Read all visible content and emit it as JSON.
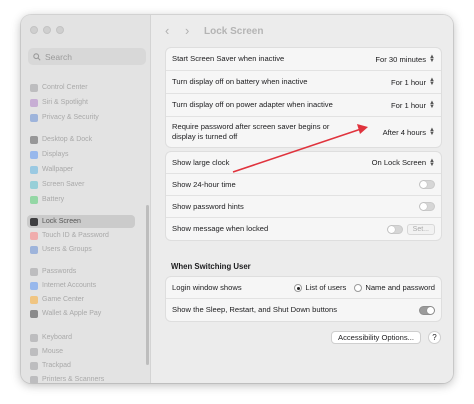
{
  "window": {
    "title": "Lock Screen"
  },
  "sidebar": {
    "search_placeholder": "Search",
    "items": [
      {
        "label": "Control Center",
        "icon": "control-center-icon",
        "color": "#8e8e93"
      },
      {
        "label": "Siri & Spotlight",
        "icon": "siri-icon",
        "color": "#a56cc1"
      },
      {
        "label": "Privacy & Security",
        "icon": "hand-icon",
        "color": "#4a7bd0"
      },
      {
        "label": "Desktop & Dock",
        "icon": "dock-icon",
        "color": "#3a3a3c"
      },
      {
        "label": "Displays",
        "icon": "display-icon",
        "color": "#3b82f6"
      },
      {
        "label": "Wallpaper",
        "icon": "wallpaper-icon",
        "color": "#40a9e0"
      },
      {
        "label": "Screen Saver",
        "icon": "screen-saver-icon",
        "color": "#39b5c9"
      },
      {
        "label": "Battery",
        "icon": "battery-icon",
        "color": "#34c759"
      },
      {
        "label": "Lock Screen",
        "icon": "lock-icon",
        "color": "#1c1c1e"
      },
      {
        "label": "Touch ID & Password",
        "icon": "fingerprint-icon",
        "color": "#ff6b6b"
      },
      {
        "label": "Users & Groups",
        "icon": "users-icon",
        "color": "#4a7bd0"
      },
      {
        "label": "Passwords",
        "icon": "key-icon",
        "color": "#8e8e93"
      },
      {
        "label": "Internet Accounts",
        "icon": "at-icon",
        "color": "#3b82f6"
      },
      {
        "label": "Game Center",
        "icon": "game-center-icon",
        "color": "#ff9f0a"
      },
      {
        "label": "Wallet & Apple Pay",
        "icon": "wallet-icon",
        "color": "#1c1c1e"
      },
      {
        "label": "Keyboard",
        "icon": "keyboard-icon",
        "color": "#8e8e93"
      },
      {
        "label": "Mouse",
        "icon": "mouse-icon",
        "color": "#8e8e93"
      },
      {
        "label": "Trackpad",
        "icon": "trackpad-icon",
        "color": "#8e8e93"
      },
      {
        "label": "Printers & Scanners",
        "icon": "printer-icon",
        "color": "#8e8e93"
      }
    ]
  },
  "screen_saver_group": [
    {
      "label": "Start Screen Saver when inactive",
      "value": "For 30 minutes"
    },
    {
      "label": "Turn display off on battery when inactive",
      "value": "For 1 hour"
    },
    {
      "label": "Turn display off on power adapter when inactive",
      "value": "For 1 hour"
    },
    {
      "label_line1": "Require password after screen saver begins or",
      "label_line2": "display is turned off",
      "value": "After 4 hours"
    }
  ],
  "lock_group": {
    "large_clock": {
      "label": "Show large clock",
      "value": "On Lock Screen"
    },
    "time_24h": {
      "label": "Show 24-hour time",
      "on": false
    },
    "password_hints": {
      "label": "Show password hints",
      "on": false
    },
    "message_locked": {
      "label": "Show message when locked",
      "on": false,
      "set_label": "Set..."
    }
  },
  "switching_user": {
    "title": "When Switching User",
    "login_window": {
      "label": "Login window shows",
      "option_list": "List of users",
      "option_name": "Name and password",
      "selected": "List of users"
    },
    "show_buttons": {
      "label": "Show the Sleep, Restart, and Shut Down buttons",
      "on": true
    }
  },
  "footer": {
    "accessibility_label": "Accessibility Options...",
    "help_label": "?"
  },
  "annotation": {
    "arrow_color": "#e0333d"
  }
}
